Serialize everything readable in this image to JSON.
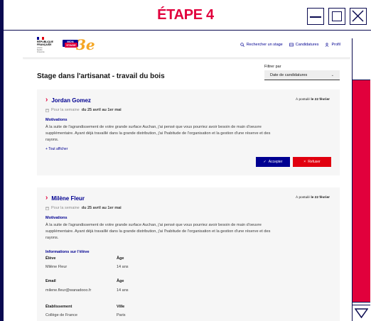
{
  "window": {
    "title": "ÉTAPE 4",
    "title_color": "#e1003c"
  },
  "header": {
    "gov_logo_lines": [
      "RÉPUBLIQUE",
      "FRANÇAISE"
    ],
    "gov_logo_motto": [
      "Liberté",
      "Égalité",
      "Fraternité"
    ],
    "brand_text": [
      "MON",
      "STAGE"
    ],
    "brand_suffix": "3e",
    "nav": [
      {
        "label": "Rechercher un stage",
        "icon": "search-icon"
      },
      {
        "label": "Candidatures",
        "icon": "inbox-icon"
      },
      {
        "label": "Profil",
        "icon": "user-icon"
      }
    ]
  },
  "main": {
    "page_title": "Stage dans l'artisanat - travail du bois",
    "filter": {
      "label": "Filtrer par",
      "selected": "Date de candidatures"
    }
  },
  "applications": [
    {
      "name": "Jordan Gomez",
      "applied_prefix": "À postulé",
      "applied_date": "le 22 février",
      "week_prefix": "Pour la semaine",
      "week_range": "du 25 avril au 1er mai",
      "motivation_label": "Motivations",
      "motivation": "À la suite de l'agrandissement de votre grande surface Auchan, j'ai pensé que vous pourriez avoir besoin de main d'oeuvre supplémentaire. Ayant déjà travaillé dans la grande distribution, j'ai l'habitude de l'organisation et la gestion d'une réserve et des rayons.",
      "show_all": "Tout afficher",
      "accept_label": "Accepter",
      "refuse_label": "Refuser"
    },
    {
      "name": "Milène Fleur",
      "applied_prefix": "À postulé",
      "applied_date": "le 22 février",
      "week_prefix": "Pour la semaine",
      "week_range": "du 25 avril au 1er mai",
      "motivation_label": "Motivations",
      "motivation": "À la suite de l'agrandissement de votre grande surface Auchan, j'ai pensé que vous pourriez avoir besoin de main d'oeuvre supplémentaire. Ayant déjà travaillé dans la grande distribution, j'ai l'habitude de l'organisation et la gestion d'une réserve et des rayons.",
      "info_title": "Informations sur l'élève",
      "info": [
        {
          "k1": "Élève",
          "v1": "Milène Fleur",
          "k2": "Âge",
          "v2": "14 ans"
        },
        {
          "k1": "Email",
          "v1": "milene.fleur@wanadooo.fr",
          "k2": "Âge",
          "v2": "14 ans"
        },
        {
          "k1": "Établissement",
          "v1": "Collège de France",
          "k2": "Ville",
          "v2": "Paris"
        }
      ]
    }
  ],
  "colors": {
    "primary": "#000091",
    "accent": "#e1003c",
    "card_bg": "#f6f6f6"
  }
}
